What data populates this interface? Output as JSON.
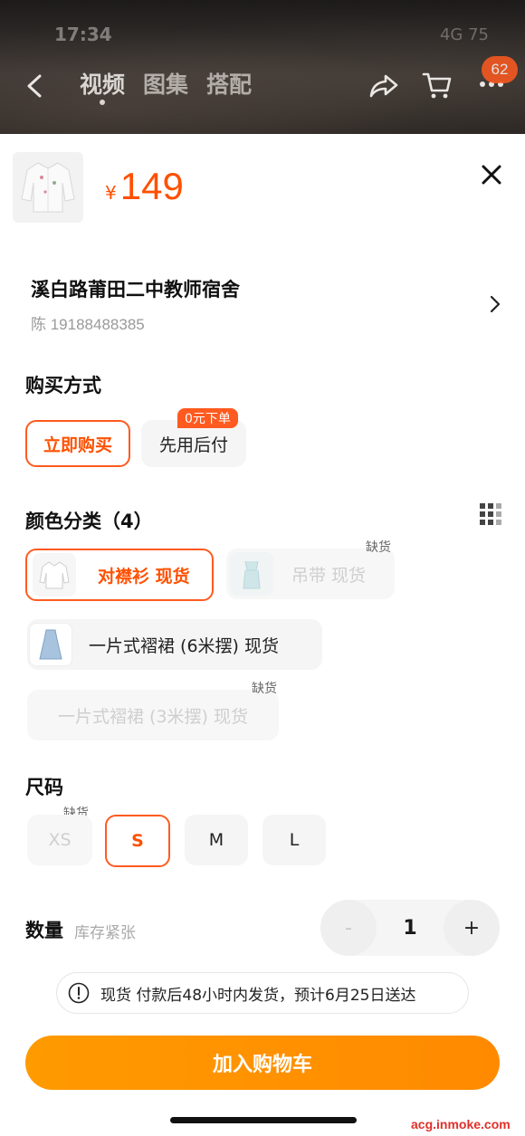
{
  "status": {
    "time": "17:34",
    "right": "4G 75"
  },
  "nav": {
    "tabs": [
      {
        "label": "视频"
      },
      {
        "label": "图集"
      },
      {
        "label": "搭配"
      }
    ],
    "badge_count": "62"
  },
  "product": {
    "currency": "¥",
    "price": "149"
  },
  "address": {
    "name": "溪白路莆田二中教师宿舍",
    "contact": "陈 19188488385"
  },
  "purchase": {
    "title": "购买方式",
    "options": [
      {
        "label": "立即购买"
      },
      {
        "label": "先用后付"
      }
    ],
    "promo_tag": "0元下单"
  },
  "color": {
    "title": "颜色分类（4）",
    "options": [
      {
        "label": "对襟衫  现货"
      },
      {
        "label": "吊带  现货",
        "tag": "缺货"
      },
      {
        "label": "一片式褶裙 (6米摆)   现货"
      },
      {
        "label": "一片式褶裙 (3米摆)   现货",
        "tag": "缺货"
      }
    ]
  },
  "size": {
    "title": "尺码",
    "options": [
      {
        "label": "XS",
        "tag": "缺货"
      },
      {
        "label": "S"
      },
      {
        "label": "M"
      },
      {
        "label": "L"
      }
    ]
  },
  "quantity": {
    "label": "数量",
    "sub": "库存紧张",
    "minus": "-",
    "value": "1",
    "plus": "+"
  },
  "notice": "现货 付款后48小时内发货，预计6月25日送达",
  "cta": "加入购物车",
  "watermark": "acg.inmoke.com"
}
